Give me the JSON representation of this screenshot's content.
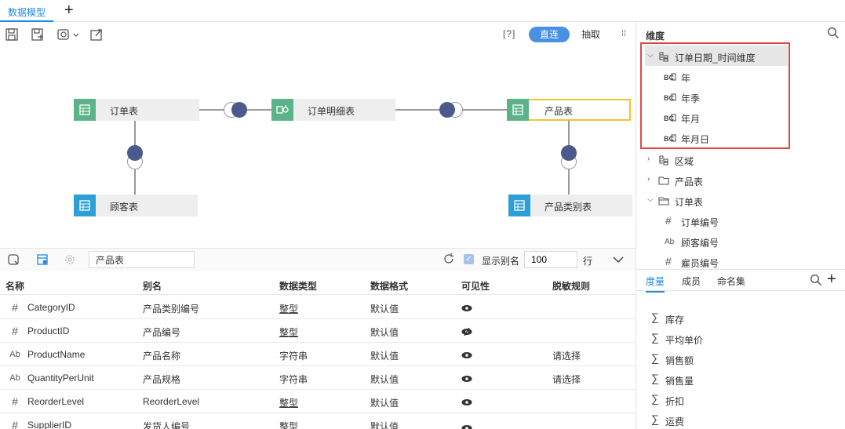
{
  "tabs": {
    "active": "数据模型",
    "add": "+"
  },
  "toolbar": {
    "help": "[?]",
    "direct": "直连",
    "extract": "抽取",
    "more": "⁞⁞"
  },
  "canvas": {
    "nodes": {
      "orders": "订单表",
      "order_details": "订单明细表",
      "products": "产品表",
      "customers": "顾客表",
      "categories": "产品类别表"
    },
    "colors": {
      "teal": "#5cb389",
      "blue": "#2e9fd6",
      "joint": "#4b5a8c",
      "selected_border": "#f5c330"
    }
  },
  "bottom": {
    "search_value": "产品表",
    "show_alias_label": "显示别名",
    "rows_value": "100",
    "rows_unit": "行",
    "columns": {
      "name": "名称",
      "alias": "别名",
      "dtype": "数据类型",
      "format": "数据格式",
      "visibility": "可见性",
      "mask": "脱敏规则"
    },
    "rows": [
      {
        "icon": "#",
        "name": "CategoryID",
        "alias": "产品类别编号",
        "dtype": "整型",
        "format": "默认值",
        "mask": ""
      },
      {
        "icon": "#",
        "name": "ProductID",
        "alias": "产品编号",
        "dtype": "整型",
        "format": "默认值",
        "mask": ""
      },
      {
        "icon": "Ab",
        "name": "ProductName",
        "alias": "产品名称",
        "dtype": "字符串",
        "format": "默认值",
        "mask": "请选择"
      },
      {
        "icon": "Ab",
        "name": "QuantityPerUnit",
        "alias": "产品规格",
        "dtype": "字符串",
        "format": "默认值",
        "mask": "请选择"
      },
      {
        "icon": "#",
        "name": "ReorderLevel",
        "alias": "ReorderLevel",
        "dtype": "整型",
        "format": "默认值",
        "mask": ""
      },
      {
        "icon": "#",
        "name": "SupplierID",
        "alias": "发货人编号",
        "dtype": "整型",
        "format": "默认值",
        "mask": ""
      }
    ]
  },
  "dimension": {
    "title": "维度",
    "tree": {
      "order_date": "订单日期_时间维度",
      "year": "年",
      "year_quarter": "年季",
      "year_month": "年月",
      "year_month_day": "年月日",
      "region": "区域",
      "products": "产品表",
      "orders": "订单表",
      "order_no": "订单编号",
      "customer_no": "顾客编号",
      "employee_no": "雇员编号"
    }
  },
  "measures": {
    "tabs": {
      "measure": "度量",
      "member": "成员",
      "named_set": "命名集",
      "add": "+"
    },
    "items": [
      "库存",
      "平均单价",
      "销售额",
      "销售量",
      "折扣",
      "运费"
    ]
  }
}
